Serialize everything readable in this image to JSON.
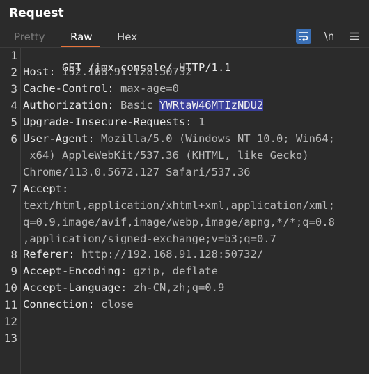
{
  "panel": {
    "title": "Request"
  },
  "tabs": {
    "pretty": "Pretty",
    "raw": "Raw",
    "hex": "Hex"
  },
  "toolbar": {
    "wrap_icon": "word-wrap-icon",
    "newline_label": "\\n",
    "menu_icon": "hamburger-menu-icon"
  },
  "line_numbers": [
    "1",
    "2",
    "3",
    "4",
    "5",
    "6",
    "7",
    "8",
    "9",
    "10",
    "11",
    "12",
    "13"
  ],
  "request": {
    "line1": "GET /jmx-console/ HTTP/1.1",
    "host_key": "Host:",
    "host_val": " 192.168.91.128:50732",
    "cache_key": "Cache-Control:",
    "cache_val": " max-age=0",
    "auth_key": "Authorization:",
    "auth_val": " Basic ",
    "auth_token": "YWRtaW46MTIzNDU2",
    "upgrade_key": "Upgrade-Insecure-Requests:",
    "upgrade_val": " 1",
    "ua_key": "User-Agent:",
    "ua_val1": " Mozilla/5.0 (Windows NT 10.0; Win64;",
    "ua_val2": " x64) AppleWebKit/537.36 (KHTML, like Gecko)",
    "ua_val3": "Chrome/113.0.5672.127 Safari/537.36",
    "accept_key": "Accept:",
    "accept_val1": "text/html,application/xhtml+xml,application/xml;",
    "accept_val2": "q=0.9,image/avif,image/webp,image/apng,*/*;q=0.8",
    "accept_val3": ",application/signed-exchange;v=b3;q=0.7",
    "referer_key": "Referer:",
    "referer_val": " http://192.168.91.128:50732/",
    "encoding_key": "Accept-Encoding:",
    "encoding_val": " gzip, deflate",
    "language_key": "Accept-Language:",
    "language_val": " zh-CN,zh;q=0.9",
    "connection_key": "Connection:",
    "connection_val": " close"
  }
}
